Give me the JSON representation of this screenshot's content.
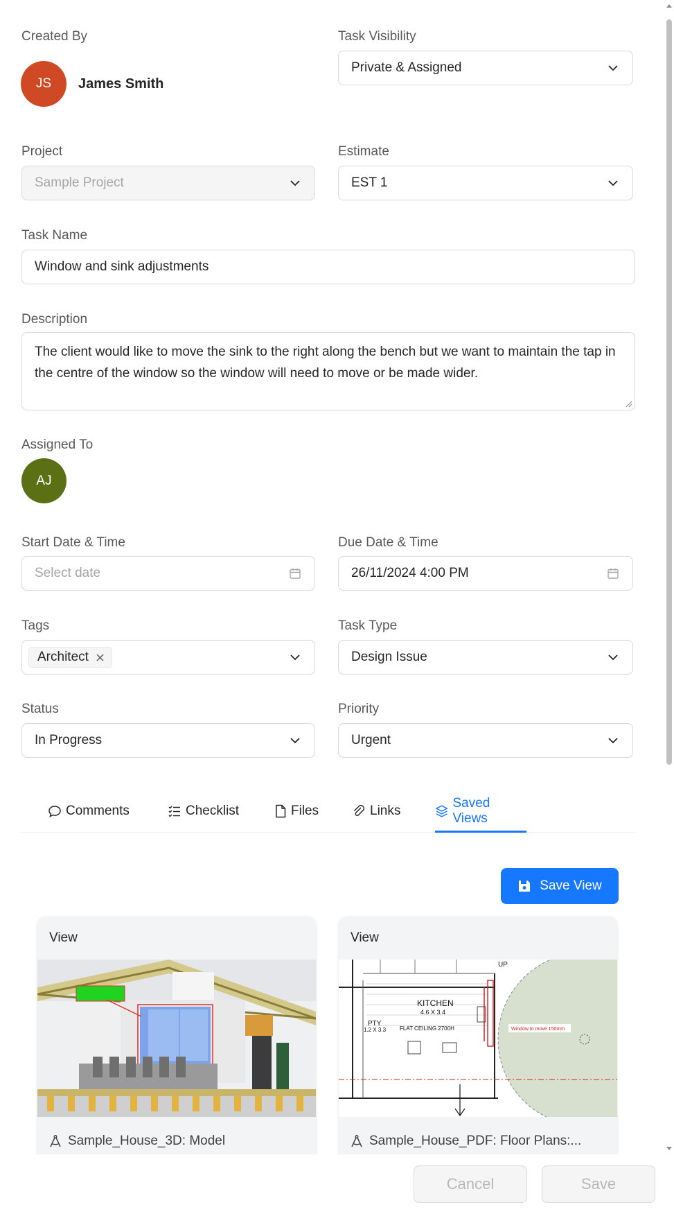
{
  "created_by": {
    "label": "Created By",
    "initials": "JS",
    "name": "James Smith",
    "avatar_color": "#cf4a24"
  },
  "task_visibility": {
    "label": "Task Visibility",
    "value": "Private & Assigned"
  },
  "project": {
    "label": "Project",
    "value": "Sample Project"
  },
  "estimate": {
    "label": "Estimate",
    "value": "EST 1"
  },
  "task_name": {
    "label": "Task Name",
    "value": "Window and sink adjustments"
  },
  "description": {
    "label": "Description",
    "value": "The client would like to move the sink to the right along the bench but we want to maintain the tap in the centre of the window so the window will need to move or be made wider."
  },
  "assigned_to": {
    "label": "Assigned To",
    "initials": "AJ",
    "avatar_color": "#5b6f14"
  },
  "start_date": {
    "label": "Start Date & Time",
    "placeholder": "Select date"
  },
  "due_date": {
    "label": "Due Date & Time",
    "value": "26/11/2024 4:00 PM"
  },
  "tags": {
    "label": "Tags",
    "items": [
      "Architect"
    ]
  },
  "task_type": {
    "label": "Task Type",
    "value": "Design Issue"
  },
  "status": {
    "label": "Status",
    "value": "In Progress"
  },
  "priority": {
    "label": "Priority",
    "value": "Urgent"
  },
  "tabs": [
    {
      "label": "Comments",
      "icon": "comment-icon"
    },
    {
      "label": "Checklist",
      "icon": "checklist-icon"
    },
    {
      "label": "Files",
      "icon": "file-icon"
    },
    {
      "label": "Links",
      "icon": "paperclip-icon"
    },
    {
      "label": "Saved Views",
      "icon": "layers-icon",
      "active": true
    }
  ],
  "save_view_label": "Save View",
  "views": [
    {
      "header": "View",
      "caption": "Sample_House_3D: Model",
      "image": "3d-model-section"
    },
    {
      "header": "View",
      "caption": "Sample_House_PDF: Floor Plans:...",
      "image": "floor-plan",
      "plan_text": {
        "up": "UP",
        "kitchen": "KITCHEN",
        "kitchen_size": "4.6 X 3.4",
        "pty": "PTY",
        "pty_size": "1.2 X 3.3",
        "ceiling": "FLAT CEILING 2700H",
        "note": "Window to move 150mm"
      }
    }
  ],
  "footer": {
    "cancel_label": "Cancel",
    "save_label": "Save"
  },
  "colors": {
    "accent": "#1677ff",
    "border": "#d9d9d9",
    "disabled_bg": "#f5f5f5"
  }
}
